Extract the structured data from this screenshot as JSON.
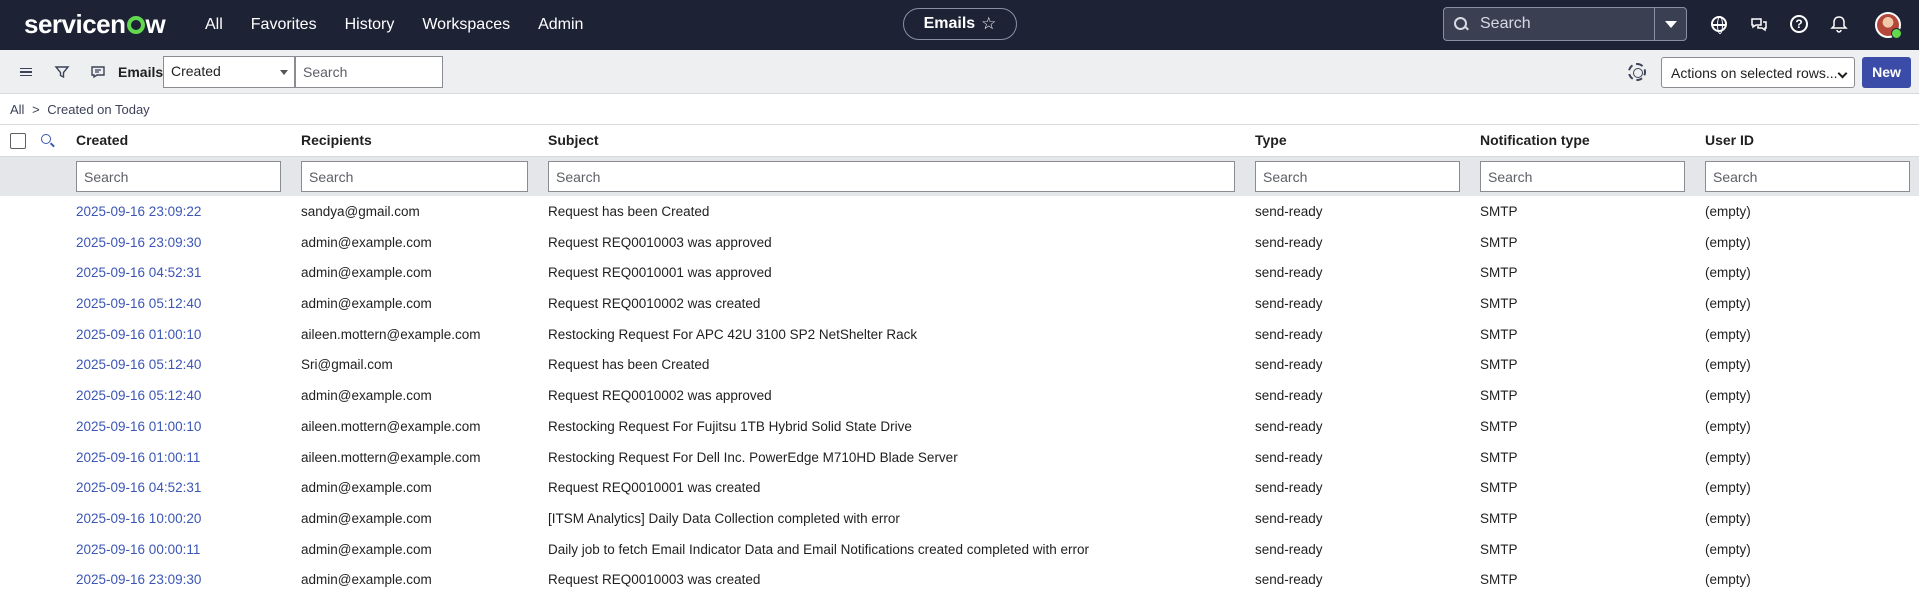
{
  "topnav": {
    "logo": "servicenow",
    "menu": [
      "All",
      "Favorites",
      "History",
      "Workspaces",
      "Admin"
    ],
    "context_title": "Emails",
    "search_placeholder": "Search"
  },
  "toolbar": {
    "title": "Emails",
    "field_select": "Created",
    "search_placeholder": "Search",
    "actions_label": "Actions on selected rows...",
    "new_label": "New"
  },
  "breadcrumb": [
    "All",
    ">",
    "Created on Today"
  ],
  "table": {
    "columns": [
      "Created",
      "Recipients",
      "Subject",
      "Type",
      "Notification type",
      "User ID"
    ],
    "filter_placeholder": "Search",
    "rows": [
      [
        "2025-09-16 23:09:22",
        "sandya@gmail.com",
        "Request has been Created",
        "send-ready",
        "SMTP",
        "(empty)"
      ],
      [
        "2025-09-16 23:09:30",
        "admin@example.com",
        "Request REQ0010003 was approved",
        "send-ready",
        "SMTP",
        "(empty)"
      ],
      [
        "2025-09-16 04:52:31",
        "admin@example.com",
        "Request REQ0010001 was approved",
        "send-ready",
        "SMTP",
        "(empty)"
      ],
      [
        "2025-09-16 05:12:40",
        "admin@example.com",
        "Request REQ0010002 was created",
        "send-ready",
        "SMTP",
        "(empty)"
      ],
      [
        "2025-09-16 01:00:10",
        "aileen.mottern@example.com",
        "Restocking Request For APC 42U 3100 SP2 NetShelter Rack",
        "send-ready",
        "SMTP",
        "(empty)"
      ],
      [
        "2025-09-16 05:12:40",
        "Sri@gmail.com",
        "Request has been Created",
        "send-ready",
        "SMTP",
        "(empty)"
      ],
      [
        "2025-09-16 05:12:40",
        "admin@example.com",
        "Request REQ0010002 was approved",
        "send-ready",
        "SMTP",
        "(empty)"
      ],
      [
        "2025-09-16 01:00:10",
        "aileen.mottern@example.com",
        "Restocking Request For Fujitsu 1TB Hybrid Solid State Drive",
        "send-ready",
        "SMTP",
        "(empty)"
      ],
      [
        "2025-09-16 01:00:11",
        "aileen.mottern@example.com",
        "Restocking Request For Dell Inc. PowerEdge M710HD Blade Server",
        "send-ready",
        "SMTP",
        "(empty)"
      ],
      [
        "2025-09-16 04:52:31",
        "admin@example.com",
        "Request REQ0010001 was created",
        "send-ready",
        "SMTP",
        "(empty)"
      ],
      [
        "2025-09-16 10:00:20",
        "admin@example.com",
        "[ITSM Analytics] Daily Data Collection completed with error",
        "send-ready",
        "SMTP",
        "(empty)"
      ],
      [
        "2025-09-16 00:00:11",
        "admin@example.com",
        "Daily job to fetch Email Indicator Data and Email Notifications created completed with error",
        "send-ready",
        "SMTP",
        "(empty)"
      ],
      [
        "2025-09-16 23:09:30",
        "admin@example.com",
        "Request REQ0010003 was created",
        "send-ready",
        "SMTP",
        "(empty)"
      ]
    ]
  },
  "colors": {
    "nav_bg": "#1e2235",
    "accent": "#3b4ca8",
    "link": "#3b56b5",
    "logo_green": "#62d84e"
  }
}
